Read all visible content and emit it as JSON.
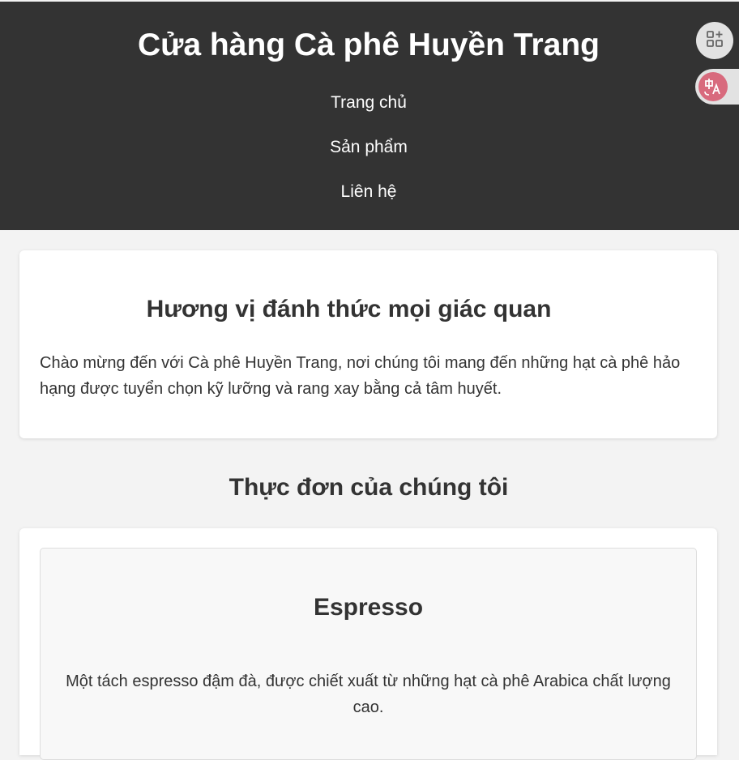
{
  "header": {
    "title": "Cửa hàng Cà phê Huyền Trang",
    "nav": [
      "Trang chủ",
      "Sản phẩm",
      "Liên hệ"
    ]
  },
  "side_buttons": [
    {
      "icon": "apps-add-icon"
    },
    {
      "icon": "translate-icon"
    }
  ],
  "hero": {
    "title": "Hương vị đánh thức mọi giác quan",
    "text": "Chào mừng đến với Cà phê Huyền Trang, nơi chúng tôi mang đến những hạt cà phê hảo hạng được tuyển chọn kỹ lưỡng và rang xay bằng cả tâm huyết."
  },
  "menu": {
    "title": "Thực đơn của chúng tôi",
    "items": [
      {
        "name": "Espresso",
        "description": "Một tách espresso đậm đà, được chiết xuất từ những hạt cà phê Arabica chất lượng cao."
      }
    ]
  },
  "colors": {
    "header_bg": "#333333",
    "page_bg": "#f3f3f3",
    "translate_accent": "#d86a7d"
  }
}
